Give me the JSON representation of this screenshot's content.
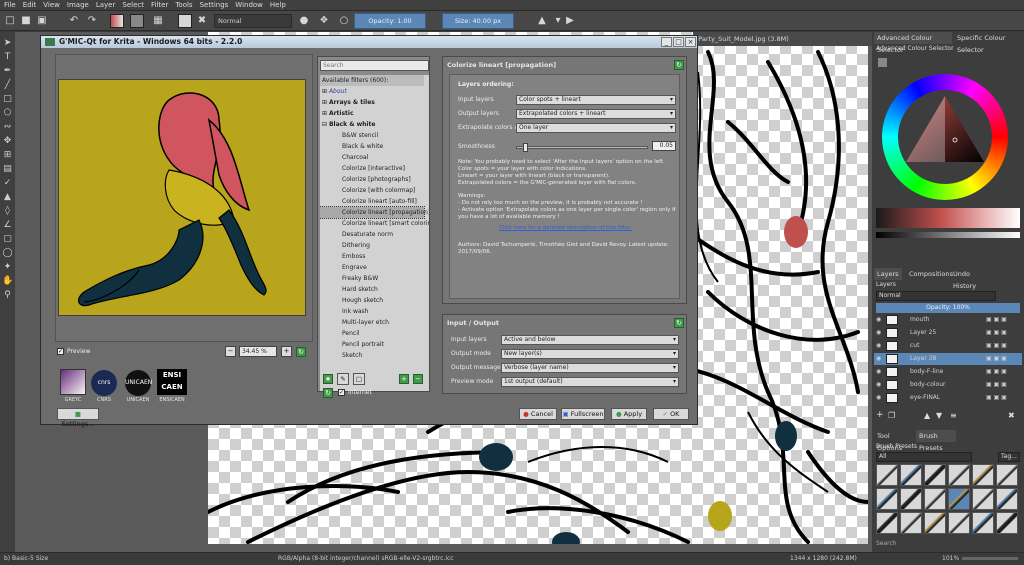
{
  "menu": [
    "File",
    "Edit",
    "View",
    "Image",
    "Layer",
    "Select",
    "Filter",
    "Tools",
    "Settings",
    "Window",
    "Help"
  ],
  "toolbar": {
    "blend_mode": "Normal",
    "opacity_label": "Opacity:  1.00",
    "size_label": "Size:  40.00 px"
  },
  "document_tab": "_Party_Suit_Model.jpg (3.8M)",
  "dialog": {
    "title": "G'MIC-Qt for Krita - Windows 64 bits - 2.2.0",
    "preview_label": "Preview",
    "zoom_value": "34.45 %",
    "settings_button": "Settings...",
    "logos": [
      {
        "name": "GREYC",
        "caption": "GREYC"
      },
      {
        "name": "CNRS",
        "caption": "CNRS"
      },
      {
        "name": "UNICAEN",
        "caption": "UNICAEN"
      },
      {
        "name": "ENSI CAEN",
        "caption": "ENSICAEN"
      }
    ],
    "search_placeholder": "Search",
    "filters_header": "Available filters (600):",
    "internet_label": "Internet",
    "categories": [
      {
        "label": "About",
        "italic": true
      },
      {
        "label": "Arrays & tiles"
      },
      {
        "label": "Artistic"
      },
      {
        "label": "Black & white",
        "expanded": true
      }
    ],
    "bw_filters": [
      "B&W stencil",
      "Black & white",
      "Charcoal",
      "Colorize [interactive]",
      "Colorize [photographs]",
      "Colorize [with colormap]",
      "Colorize lineart [auto-fill]",
      "Colorize lineart [propagation]",
      "Colorize lineart [smart coloring]",
      "Desaturate norm",
      "Dithering",
      "Emboss",
      "Engrave",
      "Freaky B&W",
      "Hard sketch",
      "Hough sketch",
      "Ink wash",
      "Multi-layer etch",
      "Pencil",
      "Pencil portrait",
      "Sketch"
    ],
    "selected_filter": "Colorize lineart [propagation]",
    "params": {
      "title": "Colorize lineart [propagation]",
      "section": "Layers ordering:",
      "rows": [
        {
          "label": "Input layers",
          "value": "Color spots + lineart"
        },
        {
          "label": "Output layers",
          "value": "Extrapolated colors + lineart"
        },
        {
          "label": "Extrapolate colors as",
          "value": "One layer"
        }
      ],
      "smoothness_label": "Smoothness",
      "smoothness_value": "0.05",
      "smoothness_fraction": 0.05,
      "note": "Note: You probably need to select 'After the Input layers' option on the left.\nColor spots = your layer with color indications.\nLineart = your layer with lineart (black or transparent).\nExtrapolated colors = the G'MIC-generated layer with flat colors.",
      "warning": "Warnings:\n- Do not rely too much on the preview, it is probably not accurate !\n- Activate option 'Extrapolate colors as one layer per single color' region only if you have a lot of available memory !",
      "link": "Click here for a detailed description of this filter.",
      "authors": "Authors: David Tschumperlé, Timothée Giet and David Revoy. Latest update: 2017/09/06."
    },
    "io": {
      "title": "Input / Output",
      "rows": [
        {
          "label": "Input layers",
          "value": "Active and below"
        },
        {
          "label": "Output mode",
          "value": "New layer(s)"
        },
        {
          "label": "Output messages",
          "value": "Verbose (layer name)"
        },
        {
          "label": "Preview mode",
          "value": "1st output (default)"
        }
      ]
    },
    "buttons": {
      "cancel": "Cancel",
      "fullscreen": "Fullscreen",
      "apply": "Apply",
      "ok": "OK"
    }
  },
  "right_panel": {
    "tabs": [
      "Advanced Colour Selector",
      "Specific Colour Selector"
    ],
    "color_selector_title": "Advanced Colour Selector",
    "layer_tabs": [
      "Layers",
      "Compositions",
      "Undo History"
    ],
    "layers_title": "Layers",
    "layer_blend": "Normal",
    "layer_opacity": "Opacity:  100%",
    "layers": [
      {
        "name": "mouth",
        "active": false
      },
      {
        "name": "Layer 25",
        "active": false
      },
      {
        "name": "cut",
        "active": false
      },
      {
        "name": "Layer 38",
        "active": true
      },
      {
        "name": "body-F-line",
        "active": false
      },
      {
        "name": "body-colour",
        "active": false
      },
      {
        "name": "eye-FINAL",
        "active": false
      }
    ],
    "tool_tabs": [
      "Tool Options",
      "Brush Presets"
    ],
    "brush_presets_title": "Brush Presets",
    "brush_filter": "All",
    "brush_tag": "Tag...",
    "search_label": "Search"
  },
  "status": {
    "brush": "b) Basic-5 Size",
    "colorspace": "RGB/Alpha (8-bit integer/channel)  sRGB-elle-V2-srgbtrc.icc",
    "image_size": "1344 x 1280 (242.8M)",
    "zoom": "101%"
  },
  "colors": {
    "accent": "#5a87b5",
    "preview_bg": "#b8a51b",
    "hair": "#d1555e",
    "ink": "#10303f",
    "dot_red": "#c0504d",
    "dot_navy": "#1e3a58",
    "dot_yellow": "#b7a619"
  }
}
